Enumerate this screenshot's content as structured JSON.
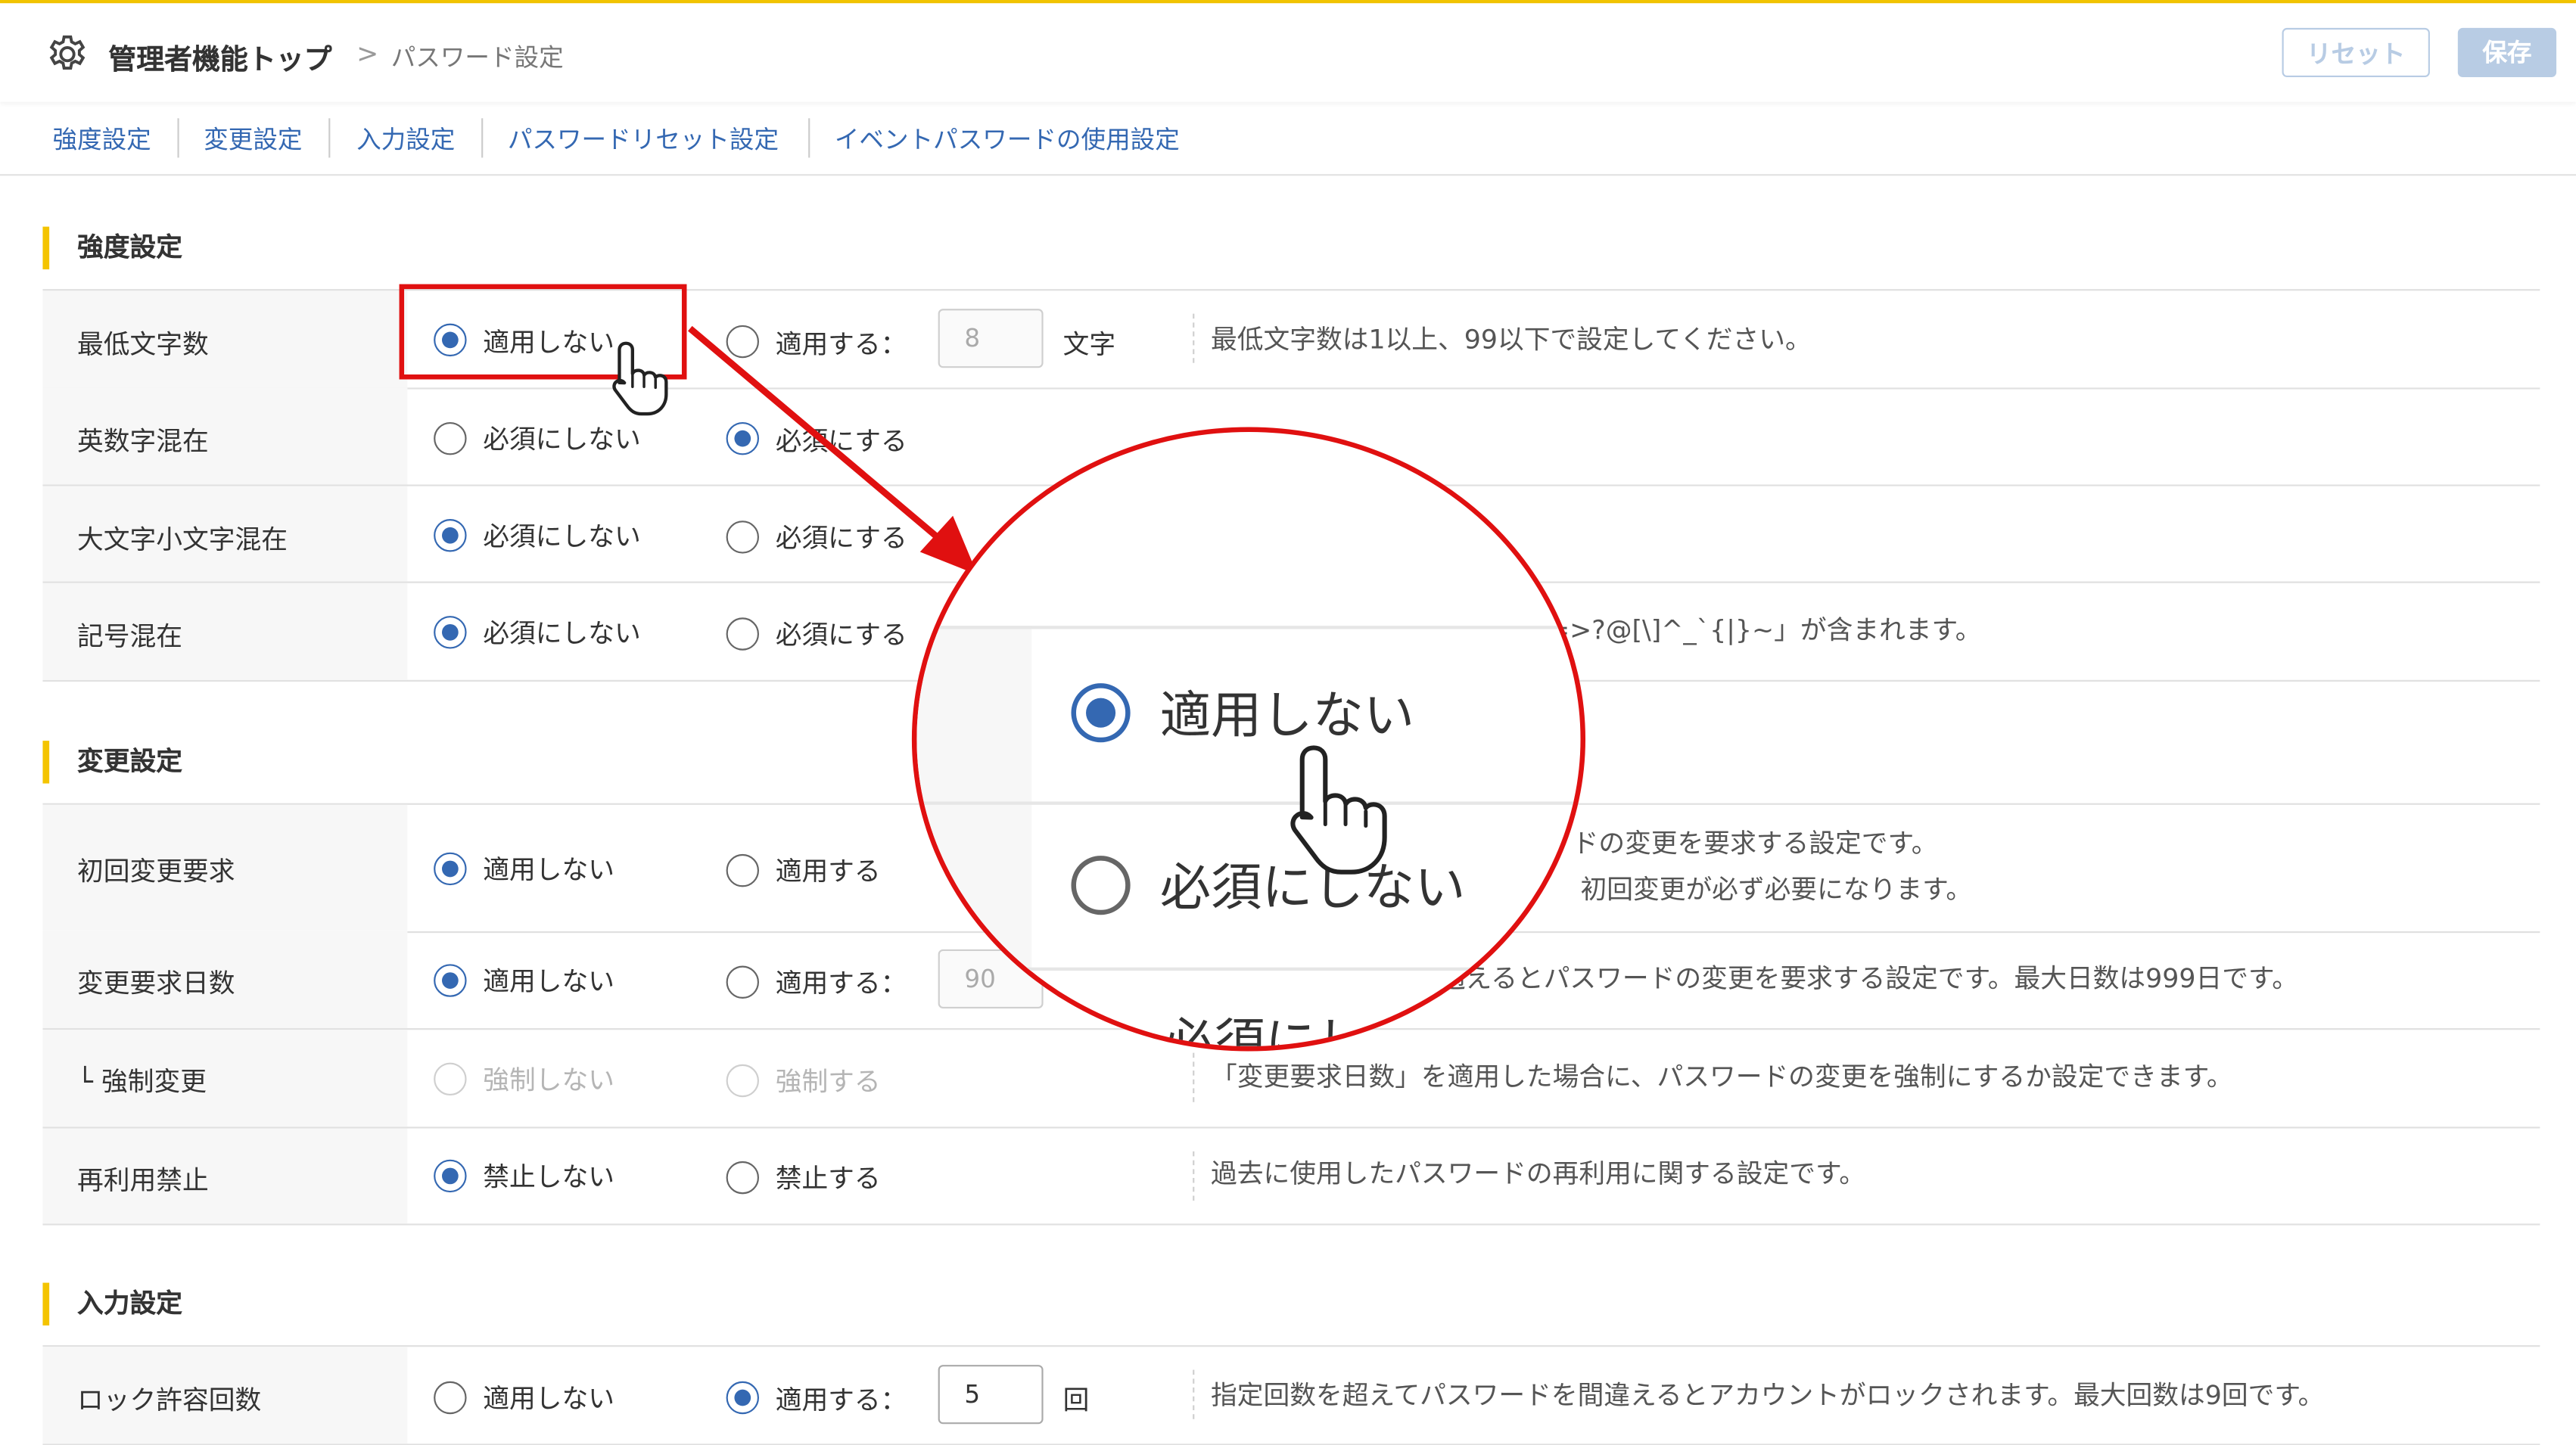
{
  "header": {
    "crumb_home": "管理者機能トップ",
    "crumb_separator": ">",
    "crumb_current": "パスワード設定",
    "reset_label": "リセット",
    "save_label": "保存",
    "icon": "gear-icon"
  },
  "tabs": [
    {
      "label": "強度設定"
    },
    {
      "label": "変更設定"
    },
    {
      "label": "入力設定"
    },
    {
      "label": "パスワードリセット設定"
    },
    {
      "label": "イベントパスワードの使用設定"
    }
  ],
  "sections": {
    "strength": {
      "title": "強度設定",
      "rows": [
        {
          "label": "最低文字数",
          "opt1": "適用しない",
          "opt2": "適用する：",
          "value": "8",
          "unit": "文字",
          "desc": "最低文字数は1以上、99以下で設定してください。"
        },
        {
          "label": "英数字混在",
          "opt1": "必須にしない",
          "opt2": "必須にする"
        },
        {
          "label": "大文字小文字混在",
          "opt1": "必須にしない",
          "opt2": "必須にする"
        },
        {
          "label": "記号混在",
          "opt1": "必須にしない",
          "opt2": "必須にする",
          "desc": "=>?@[\\]^_`{|}~」が含まれます。"
        }
      ]
    },
    "change": {
      "title": "変更設定",
      "rows": [
        {
          "label": "初回変更要求",
          "opt1": "適用しない",
          "opt2": "適用する",
          "desc1": "ドの変更を要求する設定です。",
          "desc2": "初回変更が必ず必要になります。"
        },
        {
          "label": "変更要求日数",
          "opt1": "適用しない",
          "opt2": "適用する：",
          "value": "90",
          "desc": "過えるとパスワードの変更を要求する設定です。最大日数は999日です。"
        },
        {
          "label": "└ 強制変更",
          "opt1": "強制しない",
          "opt2": "強制する",
          "desc": "「変更要求日数」を適用した場合に、パスワードの変更を強制にするか設定できます。"
        },
        {
          "label": "再利用禁止",
          "opt1": "禁止しない",
          "opt2": "禁止する",
          "desc": "過去に使用したパスワードの再利用に関する設定です。"
        }
      ]
    },
    "input": {
      "title": "入力設定",
      "rows": [
        {
          "label": "ロック許容回数",
          "opt1": "適用しない",
          "opt2": "適用する：",
          "value": "5",
          "unit": "回",
          "desc": "指定回数を超えてパスワードを間違えるとアカウントがロックされます。最大回数は9回です。"
        }
      ]
    }
  },
  "magnifier": {
    "line1": "適用しない",
    "line2": "必須にしない",
    "line3": "必須にし"
  },
  "colors": {
    "accent": "#3468b2",
    "annotation": "#e01010",
    "section_bar": "#f4c400"
  }
}
